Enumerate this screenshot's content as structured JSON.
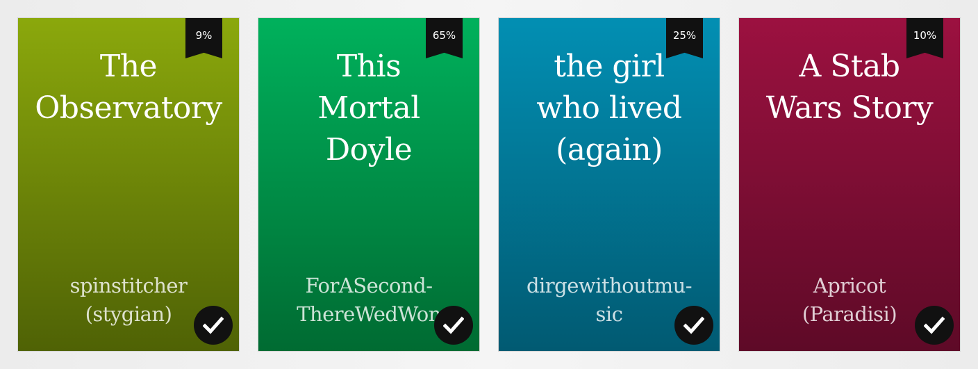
{
  "books": [
    {
      "title": "The\nObservatory",
      "author": "spinstitcher\n(stygian)",
      "progress": "9%",
      "progress_value": 0.09,
      "selected": true,
      "color_top": "#8ba80c",
      "color_bottom": "#4f6205",
      "icon": "checkmark-icon"
    },
    {
      "title": "This\nMortal\nDoyle",
      "author": "ForASecond-\nThereWedWon",
      "progress": "65%",
      "progress_value": 0.65,
      "selected": true,
      "color_top": "#00b15c",
      "color_bottom": "#006b32",
      "icon": "checkmark-icon"
    },
    {
      "title": "the girl\nwho lived\n(again)",
      "author": "dirgewithoutmu-\nsic",
      "progress": "25%",
      "progress_value": 0.25,
      "selected": true,
      "color_top": "#028fb3",
      "color_bottom": "#015a72",
      "icon": "checkmark-icon"
    },
    {
      "title": "A Stab\nWars Story",
      "author": "Apricot\n(Paradisi)",
      "progress": "10%",
      "progress_value": 0.1,
      "selected": true,
      "color_top": "#9c1140",
      "color_bottom": "#5e0a27",
      "icon": "checkmark-icon"
    }
  ]
}
